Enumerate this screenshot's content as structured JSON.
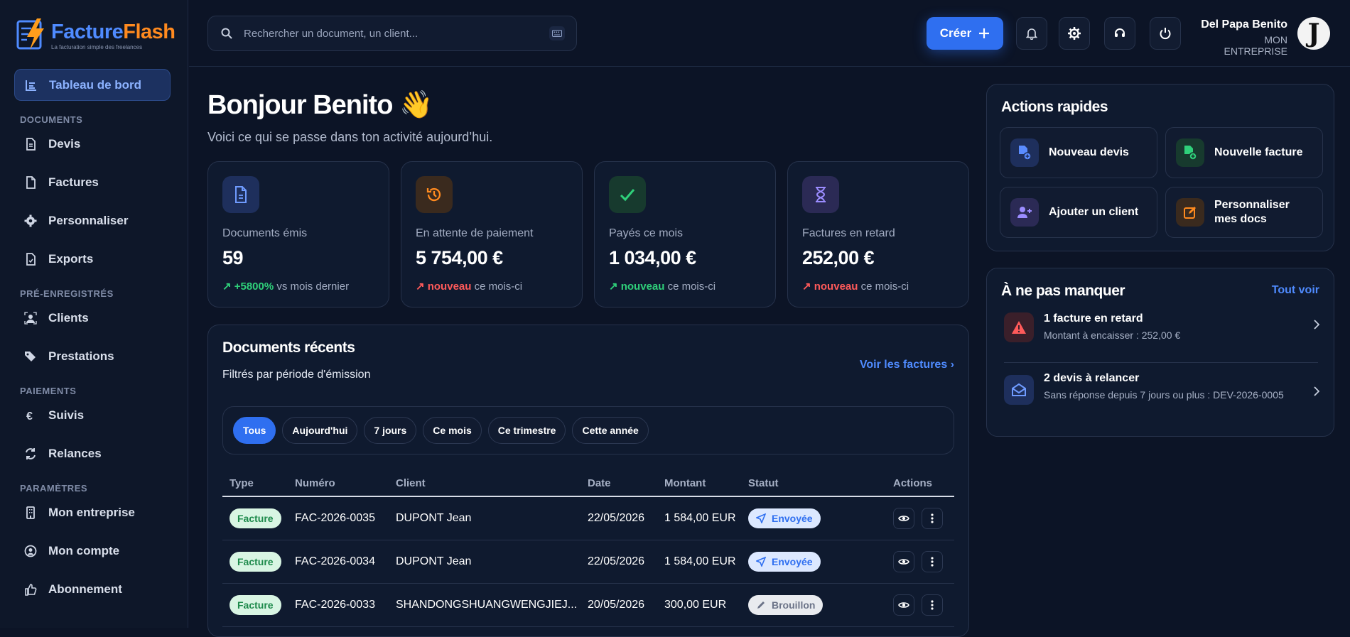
{
  "brand": {
    "name_a": "Facture",
    "name_b": "Flash",
    "tagline": "La facturation simple des freelances"
  },
  "sidebar": {
    "active": "Tableau de bord",
    "sections": [
      {
        "title": "DOCUMENTS",
        "items": [
          "Devis",
          "Factures",
          "Personnaliser",
          "Exports"
        ]
      },
      {
        "title": "PRÉ-ENREGISTRÉS",
        "items": [
          "Clients",
          "Prestations"
        ]
      },
      {
        "title": "PAIEMENTS",
        "items": [
          "Suivis",
          "Relances"
        ]
      },
      {
        "title": "PARAMÈTRES",
        "items": [
          "Mon entreprise",
          "Mon compte",
          "Abonnement"
        ]
      }
    ]
  },
  "topbar": {
    "search_placeholder": "Rechercher un document, un client...",
    "create_label": "Créer",
    "user_name": "Del Papa Benito",
    "user_company": "MON ENTREPRISE",
    "avatar_letter": "J"
  },
  "greeting": {
    "title": "Bonjour Benito 👋",
    "subtitle": "Voici ce qui se passe dans ton activité aujourd’hui."
  },
  "stats": [
    {
      "label": "Documents émis",
      "value": "59",
      "trend": "↗ +5800%",
      "trend_suffix": " vs mois dernier",
      "trend_type": "up"
    },
    {
      "label": "En attente de paiement",
      "value": "5 754,00 €",
      "trend": "↗ nouveau",
      "trend_suffix": " ce mois-ci",
      "trend_type": "new"
    },
    {
      "label": "Payés ce mois",
      "value": "1 034,00 €",
      "trend": "↗ nouveau",
      "trend_suffix": " ce mois-ci",
      "trend_type": "up"
    },
    {
      "label": "Factures en retard",
      "value": "252,00 €",
      "trend": "↗ nouveau",
      "trend_suffix": " ce mois-ci",
      "trend_type": "new"
    }
  ],
  "recent": {
    "title": "Documents récents",
    "subtitle": "Filtrés par période d'émission",
    "link": "Voir les factures ›",
    "filters": [
      "Tous",
      "Aujourd'hui",
      "7 jours",
      "Ce mois",
      "Ce trimestre",
      "Cette année"
    ],
    "active_filter": "Tous",
    "columns": [
      "Type",
      "Numéro",
      "Client",
      "Date",
      "Montant",
      "Statut",
      "Actions"
    ],
    "rows": [
      {
        "type": "Facture",
        "number": "FAC-2026-0035",
        "client": "DUPONT Jean",
        "date": "22/05/2026",
        "amount": "1 584,00 EUR",
        "status": "Envoyée"
      },
      {
        "type": "Facture",
        "number": "FAC-2026-0034",
        "client": "DUPONT Jean",
        "date": "22/05/2026",
        "amount": "1 584,00 EUR",
        "status": "Envoyée"
      },
      {
        "type": "Facture",
        "number": "FAC-2026-0033",
        "client": "SHANDONGSHUANGWENGJIEJ...",
        "date": "20/05/2026",
        "amount": "300,00 EUR",
        "status": "Brouillon"
      }
    ]
  },
  "quick_actions": {
    "title": "Actions rapides",
    "items": [
      "Nouveau devis",
      "Nouvelle facture",
      "Ajouter un client",
      "Personnaliser mes docs"
    ]
  },
  "alerts": {
    "title": "À ne pas manquer",
    "link": "Tout voir",
    "items": [
      {
        "title": "1 facture en retard",
        "text": "Montant à encaisser : 252,00 €"
      },
      {
        "title": "2 devis à relancer",
        "text": "Sans réponse depuis 7 jours ou plus : DEV-2026-0005"
      }
    ]
  },
  "colors": {
    "accent": "#2f6ff0",
    "orange": "#ff8a1f",
    "green": "#2fd07a",
    "red": "#ff5a5a",
    "purple": "#8b7dff"
  }
}
